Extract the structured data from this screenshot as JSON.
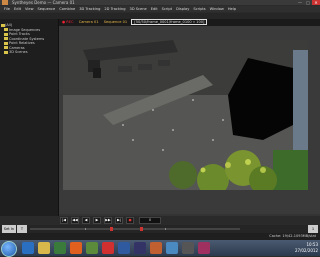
{
  "window": {
    "title": "Syntheyes Demo — Camera 01",
    "controls": [
      "—",
      "□",
      "✕"
    ]
  },
  "menu": [
    "File",
    "Edit",
    "View",
    "Sequence",
    "Combine",
    "3D Tracking",
    "2D Tracking",
    "3D Scene",
    "Edit",
    "Script",
    "Display",
    "Scripts",
    "Window",
    "Help"
  ],
  "sidebar": {
    "root": "(All)",
    "items": [
      "Image Sequences",
      "Point Tracks",
      "Coordinate Systems",
      "Point Relatives",
      "Cameras",
      "3D Scenes"
    ]
  },
  "viewer": {
    "rec_label": "● REC",
    "sequence_name": "Camera 01",
    "sequence_info": "Sequence 01",
    "clip_label": "[50/50/frame_0001/frame_0100 » 100]"
  },
  "transport": {
    "buttons": [
      "|◀",
      "◀◀",
      "◀",
      "▶",
      "▶▶",
      "▶|",
      "●"
    ],
    "frame": "0"
  },
  "timeline": {
    "left_btn_a": "Set In",
    "left_btn_b": "T",
    "right_btn": "1",
    "cache_text": "Cache: 19/42-1093MB/stat"
  },
  "taskbar": {
    "time": "10:53",
    "date": "27/02/2012"
  }
}
